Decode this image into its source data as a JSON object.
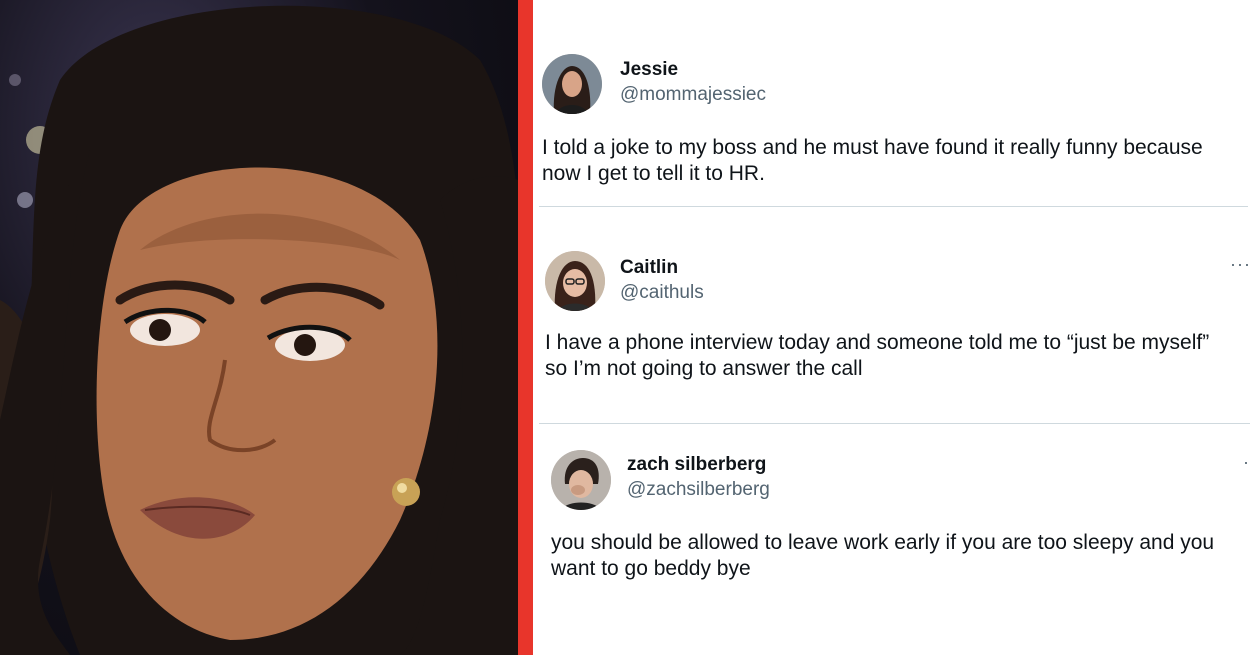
{
  "photo": {
    "alt": "woman making a grimacing face"
  },
  "tweets": [
    {
      "name": "Jessie",
      "handle": "@mommajessiec",
      "text": "I told a joke to my boss and he must have found it really funny because\nnow I get to tell it to HR.",
      "avatar": "avatar-jessie"
    },
    {
      "name": "Caitlin",
      "handle": "@caithuls",
      "text": "I have a phone interview today and someone told me to “just be myself”\nso I’m not going to answer the call",
      "more": "···",
      "avatar": "avatar-caitlin"
    },
    {
      "name": "zach silberberg",
      "handle": "@zachsilberberg",
      "text": "you should be allowed to leave work early if you are too sleepy and you\nwant to go beddy bye",
      "more": "·",
      "avatar": "avatar-zach"
    }
  ],
  "colors": {
    "divider": "#e8352b",
    "handle": "#536471",
    "text": "#0f1419"
  }
}
